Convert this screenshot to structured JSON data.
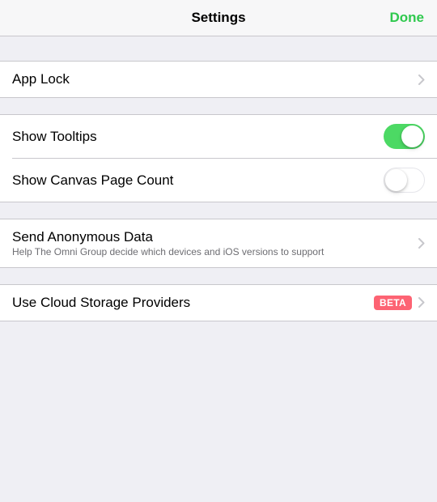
{
  "header": {
    "title": "Settings",
    "done_label": "Done"
  },
  "rows": {
    "app_lock": {
      "label": "App Lock"
    },
    "show_tooltips": {
      "label": "Show Tooltips",
      "value": true
    },
    "show_canvas_page_count": {
      "label": "Show Canvas Page Count",
      "value": false
    },
    "send_anon": {
      "label": "Send Anonymous Data",
      "sublabel": "Help The Omni Group decide which devices and iOS versions to support"
    },
    "cloud_storage": {
      "label": "Use Cloud Storage Providers",
      "badge": "BETA"
    }
  },
  "colors": {
    "accent": "#2fc94e",
    "switch_on": "#4cd964",
    "badge_bg": "#fd6373"
  }
}
